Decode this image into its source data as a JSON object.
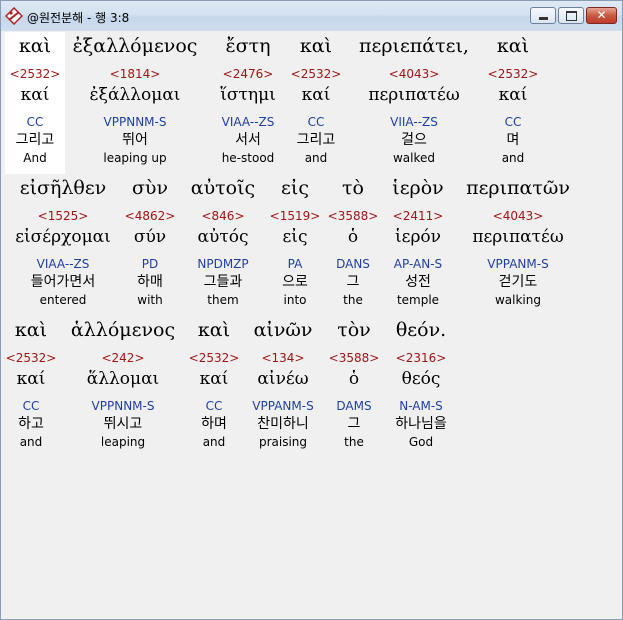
{
  "window": {
    "title": "@원전분해 - 행 3:8"
  },
  "rows": [
    {
      "words": [
        {
          "greek": "καὶ",
          "strong": "<2532>",
          "lemma": "καί",
          "parse": "CC",
          "korean": "그리고",
          "english": "And"
        },
        {
          "greek": "ἐξαλλόμενος",
          "strong": "<1814>",
          "lemma": "ἐξάλλομαι",
          "parse": "VPPNNM-S",
          "korean": "뛰어",
          "english": "leaping up"
        },
        {
          "greek": "ἔστη",
          "strong": "<2476>",
          "lemma": "ἵστημι",
          "parse": "VIAA--ZS",
          "korean": "서서",
          "english": "he-stood"
        },
        {
          "greek": "καὶ",
          "strong": "<2532>",
          "lemma": "καί",
          "parse": "CC",
          "korean": "그리고",
          "english": "and"
        },
        {
          "greek": "περιεπάτει,",
          "strong": "<4043>",
          "lemma": "περιπατέω",
          "parse": "VIIA--ZS",
          "korean": "걸으",
          "english": "walked"
        },
        {
          "greek": "καὶ",
          "strong": "<2532>",
          "lemma": "καί",
          "parse": "CC",
          "korean": "며",
          "english": "and"
        }
      ]
    },
    {
      "words": [
        {
          "greek": "εἰσῆλθεν",
          "strong": "<1525>",
          "lemma": "εἰσέρχομαι",
          "parse": "VIAA--ZS",
          "korean": "들어가면서",
          "english": "entered"
        },
        {
          "greek": "σὺν",
          "strong": "<4862>",
          "lemma": "σύν",
          "parse": "PD",
          "korean": "하매",
          "english": "with"
        },
        {
          "greek": "αὐτοῖς",
          "strong": "<846>",
          "lemma": "αὐτός",
          "parse": "NPDMZP",
          "korean": "그들과",
          "english": "them"
        },
        {
          "greek": "εἰς",
          "strong": "<1519>",
          "lemma": "εἰς",
          "parse": "PA",
          "korean": "으로",
          "english": "into"
        },
        {
          "greek": "τὸ",
          "strong": "<3588>",
          "lemma": "ὁ",
          "parse": "DANS",
          "korean": "그",
          "english": "the"
        },
        {
          "greek": "ἱερὸν",
          "strong": "<2411>",
          "lemma": "ἱερόν",
          "parse": "AP-AN-S",
          "korean": "성전",
          "english": "temple"
        },
        {
          "greek": "περιπατῶν",
          "strong": "<4043>",
          "lemma": "περιπατέω",
          "parse": "VPPANM-S",
          "korean": "걷기도",
          "english": "walking"
        }
      ]
    },
    {
      "words": [
        {
          "greek": "καὶ",
          "strong": "<2532>",
          "lemma": "καί",
          "parse": "CC",
          "korean": "하고",
          "english": "and"
        },
        {
          "greek": "ἁλλόμενος",
          "strong": "<242>",
          "lemma": "ἅλλομαι",
          "parse": "VPPNNM-S",
          "korean": "뛰시고",
          "english": "leaping"
        },
        {
          "greek": "καὶ",
          "strong": "<2532>",
          "lemma": "καί",
          "parse": "CC",
          "korean": "하며",
          "english": "and"
        },
        {
          "greek": "αἰνῶν",
          "strong": "<134>",
          "lemma": "αἰνέω",
          "parse": "VPPANM-S",
          "korean": "찬미하니",
          "english": "praising"
        },
        {
          "greek": "τὸν",
          "strong": "<3588>",
          "lemma": "ὁ",
          "parse": "DAMS",
          "korean": "그",
          "english": "the"
        },
        {
          "greek": "θεόν.",
          "strong": "<2316>",
          "lemma": "θεός",
          "parse": "N-AM-S",
          "korean": "하나님을",
          "english": "God"
        }
      ]
    }
  ]
}
